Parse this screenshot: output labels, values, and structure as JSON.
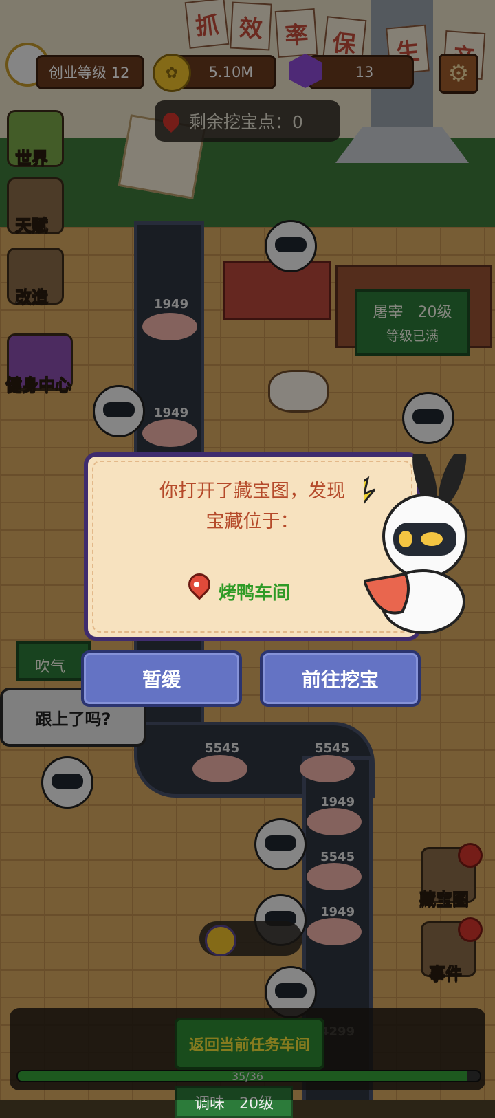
{
  "hud": {
    "level_label": "创业等级 12",
    "coins": "5.10M",
    "gems": "13",
    "dig_points": "剩余挖宝点：0"
  },
  "banner_chars": [
    "抓",
    "效",
    "率",
    "保",
    "生",
    "产"
  ],
  "side_menu": {
    "world": "世界",
    "talent": "天赋",
    "remodel": "改造",
    "gym": "健身中心"
  },
  "right_menu": {
    "treasure_map": "藏宝图",
    "events": "事件"
  },
  "stations": {
    "slaughter_title": "屠宰",
    "slaughter_level": "20级",
    "slaughter_status": "等级已满",
    "blow_title": "吹气",
    "season_title": "调味",
    "season_level": "20级"
  },
  "conveyor_numbers": [
    "1949",
    "1949",
    "5545",
    "5545",
    "1949",
    "5545",
    "1949",
    "4299"
  ],
  "dialog": {
    "message_line1": "你打开了藏宝图，发现",
    "message_line2": "宝藏位于：",
    "location": "烤鸭车间",
    "postpone_button": "暂缓",
    "go_dig_button": "前往挖宝"
  },
  "speech_bubble": "跟上了吗?",
  "bottom": {
    "return_button": "返回当前任务车间",
    "progress_text": "35/36",
    "progress_value": 0.972
  },
  "colors": {
    "dialog_bg": "#f7e2bf",
    "dialog_border": "#3f2c6e",
    "button_blue": "#6473c4",
    "location_green": "#2f9b26",
    "message_brown": "#b54a2a"
  }
}
